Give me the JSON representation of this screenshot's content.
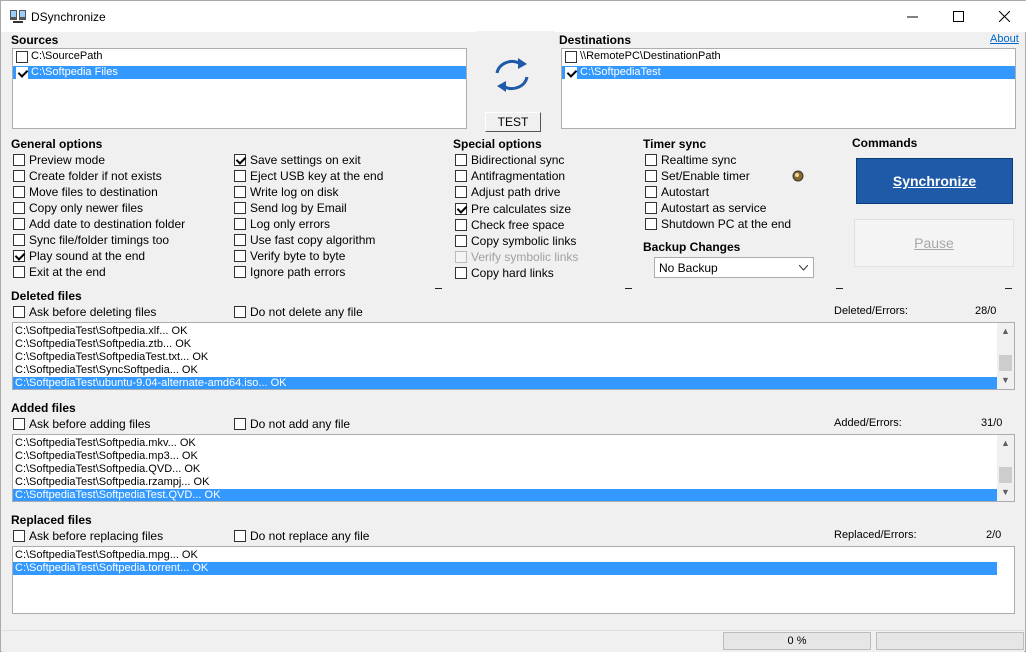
{
  "window": {
    "title": "DSynchronize"
  },
  "sources": {
    "header": "Sources",
    "items": [
      {
        "label": "C:\\SourcePath",
        "checked": false,
        "selected": false
      },
      {
        "label": "C:\\Softpedia Files",
        "checked": true,
        "selected": true
      }
    ]
  },
  "test_button": "TEST",
  "destinations": {
    "header": "Destinations",
    "about": "About",
    "items": [
      {
        "label": "\\\\RemotePC\\DestinationPath",
        "checked": false,
        "selected": false
      },
      {
        "label": "C:\\SoftpediaTest",
        "checked": true,
        "selected": true
      }
    ]
  },
  "general": {
    "header": "General options",
    "col1": [
      {
        "label": "Preview mode",
        "checked": false
      },
      {
        "label": "Create folder if not exists",
        "checked": false
      },
      {
        "label": "Move files to destination",
        "checked": false
      },
      {
        "label": "Copy only newer files",
        "checked": false
      },
      {
        "label": "Add date to destination folder",
        "checked": false
      },
      {
        "label": "Sync file/folder timings too",
        "checked": false
      },
      {
        "label": "Play sound at the end",
        "checked": true
      },
      {
        "label": "Exit at the end",
        "checked": false
      }
    ],
    "col2": [
      {
        "label": "Save settings on exit",
        "checked": true
      },
      {
        "label": "Eject USB key at the end",
        "checked": false
      },
      {
        "label": "Write log on disk",
        "checked": false
      },
      {
        "label": "Send log by Email",
        "checked": false
      },
      {
        "label": "Log only errors",
        "checked": false
      },
      {
        "label": "Use fast copy algorithm",
        "checked": false
      },
      {
        "label": "Verify byte to byte",
        "checked": false
      },
      {
        "label": "Ignore path errors",
        "checked": false
      }
    ]
  },
  "special": {
    "header": "Special options",
    "items": [
      {
        "label": "Bidirectional sync",
        "checked": false,
        "disabled": false
      },
      {
        "label": "Antifragmentation",
        "checked": false,
        "disabled": false
      },
      {
        "label": "Adjust path drive",
        "checked": false,
        "disabled": false
      },
      {
        "label": "Pre calculates size",
        "checked": true,
        "disabled": false
      },
      {
        "label": "Check free space",
        "checked": false,
        "disabled": false
      },
      {
        "label": "Copy symbolic links",
        "checked": false,
        "disabled": false
      },
      {
        "label": "Verify symbolic links",
        "checked": false,
        "disabled": true
      },
      {
        "label": "Copy hard links",
        "checked": false,
        "disabled": false
      }
    ]
  },
  "timer": {
    "header": "Timer sync",
    "items": [
      {
        "label": "Realtime sync",
        "checked": false
      },
      {
        "label": "Set/Enable timer",
        "checked": false
      },
      {
        "label": "Autostart",
        "checked": false
      },
      {
        "label": "Autostart as service",
        "checked": false
      },
      {
        "label": "Shutdown PC at the end",
        "checked": false
      }
    ],
    "backup_header": "Backup Changes",
    "backup_value": "No Backup"
  },
  "commands": {
    "header": "Commands",
    "synchronize": "Synchronize",
    "pause": "Pause"
  },
  "deleted": {
    "header": "Deleted files",
    "ask": "Ask before deleting files",
    "none": "Do not delete any file",
    "counter_label": "Deleted/Errors:",
    "counter_value": "28/0",
    "rows": [
      "C:\\SoftpediaTest\\Softpedia.xlf... OK",
      "C:\\SoftpediaTest\\Softpedia.ztb... OK",
      "C:\\SoftpediaTest\\SoftpediaTest.txt... OK",
      "C:\\SoftpediaTest\\SyncSoftpedia... OK",
      "C:\\SoftpediaTest\\ubuntu-9.04-alternate-amd64.iso... OK"
    ]
  },
  "added": {
    "header": "Added files",
    "ask": "Ask before adding files",
    "none": "Do not add any file",
    "counter_label": "Added/Errors:",
    "counter_value": "31/0",
    "rows": [
      "C:\\SoftpediaTest\\Softpedia.mkv... OK",
      "C:\\SoftpediaTest\\Softpedia.mp3... OK",
      "C:\\SoftpediaTest\\Softpedia.QVD... OK",
      "C:\\SoftpediaTest\\Softpedia.rzampj... OK",
      "C:\\SoftpediaTest\\SoftpediaTest.QVD... OK"
    ]
  },
  "replaced": {
    "header": "Replaced files",
    "ask": "Ask before replacing files",
    "none": "Do not replace any file",
    "counter_label": "Replaced/Errors:",
    "counter_value": "2/0",
    "rows": [
      "C:\\SoftpediaTest\\Softpedia.mpg... OK",
      "C:\\SoftpediaTest\\Softpedia.torrent... OK"
    ]
  },
  "progress": {
    "value": "0 %",
    "fraction": 0
  },
  "colors": {
    "accent": "#1e5aa8",
    "selection": "#3399ff"
  }
}
